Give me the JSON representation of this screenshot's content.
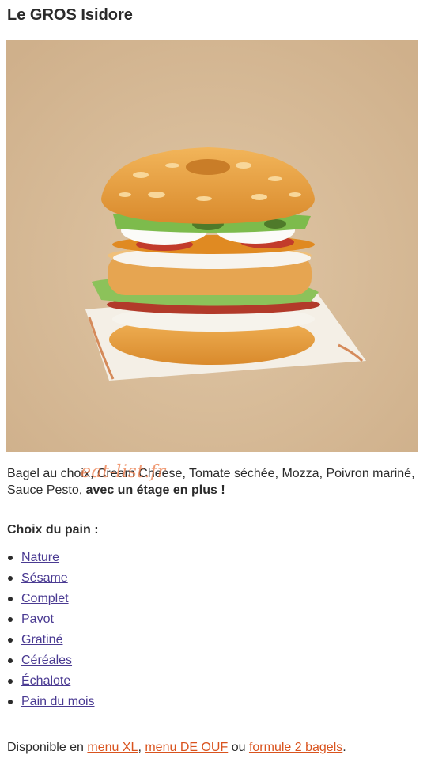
{
  "title": "Le GROS Isidore",
  "hero": {
    "alt": "Bagel double étage"
  },
  "watermark": "eat-list.fr",
  "description": {
    "ingredients": "Bagel au choix, Cream Cheese, Tomate séchée, Mozza, Poivron mariné, Sauce Pesto, ",
    "emphasis": "avec un étage en plus !"
  },
  "bread_choice": {
    "heading": "Choix du pain :",
    "options": [
      "Nature",
      "Sésame",
      "Complet",
      "Pavot",
      "Gratiné",
      "Céréales",
      "Échalote",
      "Pain du mois"
    ]
  },
  "availability": {
    "prefix": "Disponible en ",
    "link1": "menu XL",
    "sep1": ", ",
    "link2": "menu DE OUF",
    "sep2": " ou ",
    "link3": "formule 2 bagels",
    "suffix": "."
  }
}
